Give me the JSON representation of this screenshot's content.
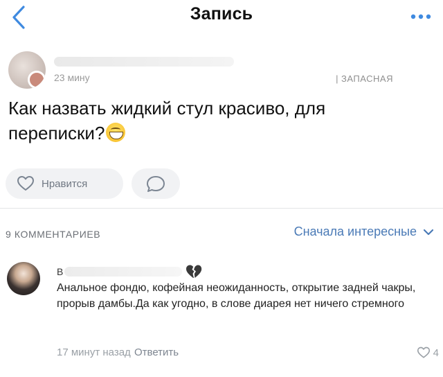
{
  "header": {
    "title": "Запись",
    "back_icon": "chevron-left-icon",
    "more_icon": "more-dots-icon"
  },
  "post": {
    "author_meta": "23 мину",
    "tag": "| ЗАПАСНАЯ",
    "text": "Как назвать жидкий стул красиво, для переписки?",
    "emoji": "grinning-face-emoji",
    "like_label": "Нравится"
  },
  "comments": {
    "count_label": "9 КОММЕНТАРИЕВ",
    "sort_label": "Сначала интересные",
    "items": [
      {
        "name_initial": "В",
        "text": "Анальное фондю, кофейная неожиданность, открытие задней чакры, прорыв дамбы.Да как угодно, в слове диарея нет ничего стремного",
        "time": "17 минут назад",
        "reply_label": "Ответить",
        "likes": "4"
      }
    ]
  },
  "colors": {
    "accent": "#4a7ab6",
    "back_icon": "#3f8ae0",
    "muted": "#9aa0a6",
    "button_bg": "#f1f2f4"
  }
}
